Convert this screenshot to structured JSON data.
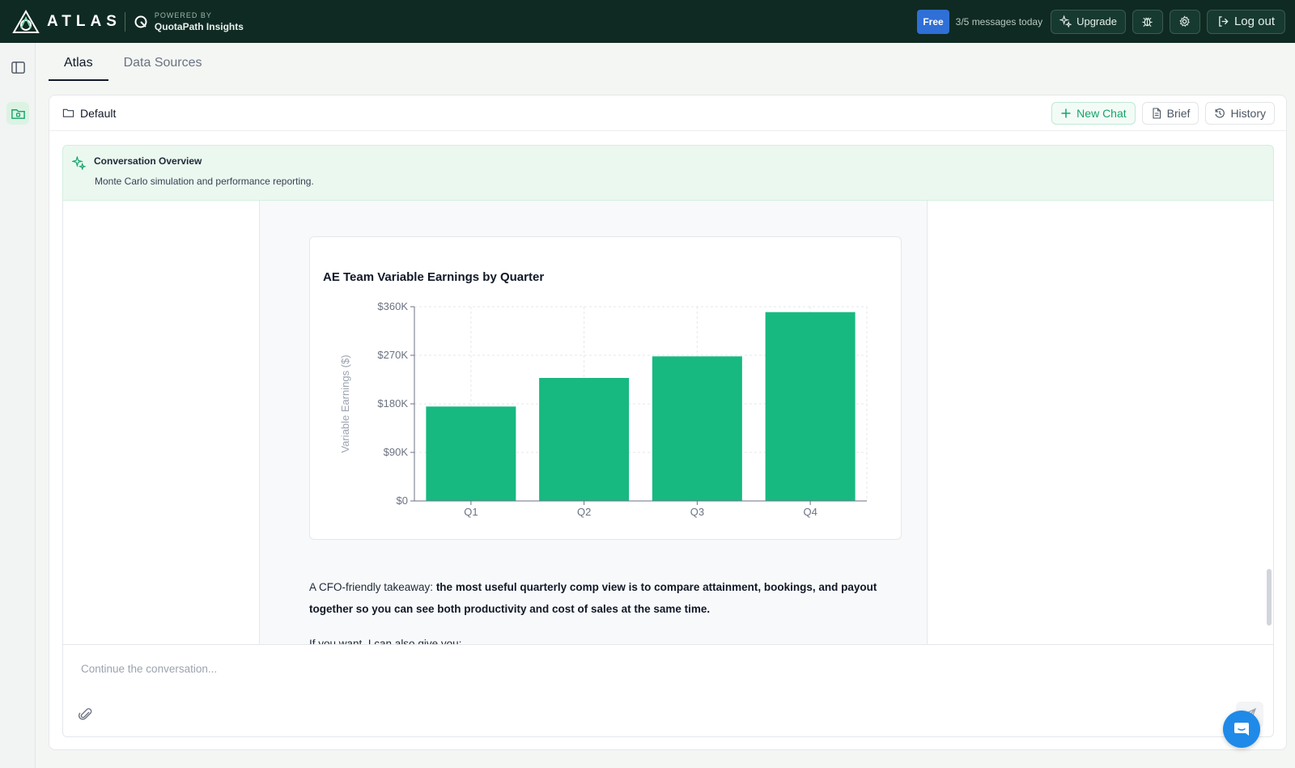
{
  "app": {
    "logo_text": "ATLAS",
    "powered_by": "POWERED BY",
    "powered_name": "QuotaPath Insights"
  },
  "topbar": {
    "plan_badge": "Free",
    "message_count": "3/5 messages today",
    "upgrade_label": "Upgrade",
    "logout_label": "Log out"
  },
  "tabs": [
    {
      "label": "Atlas"
    },
    {
      "label": "Data Sources"
    }
  ],
  "workspace": {
    "folder_name": "Default",
    "new_chat_label": "New Chat",
    "brief_label": "Brief",
    "history_label": "History"
  },
  "overview": {
    "title": "Conversation Overview",
    "summary": "Monte Carlo simulation and performance reporting."
  },
  "message": {
    "takeaway_intro": "A CFO-friendly takeaway: ",
    "takeaway_bold": "the most useful quarterly comp view is to compare attainment, bookings, and payout together so you can see both productivity and cost of sales at the same time.",
    "cutoff_line": "If you want, I can also give you:"
  },
  "composer": {
    "placeholder": "Continue the conversation..."
  },
  "colors": {
    "topbar_bg": "#0f2a22",
    "accent_green": "#17b981",
    "badge_blue": "#2f6fd6"
  },
  "chart_data": {
    "type": "bar",
    "title": "AE Team Variable Earnings by Quarter",
    "xlabel": "",
    "ylabel": "Variable Earnings ($)",
    "categories": [
      "Q1",
      "Q2",
      "Q3",
      "Q4"
    ],
    "values": [
      175000,
      228000,
      268000,
      350000
    ],
    "ylim": [
      0,
      360000
    ],
    "yticks": [
      0,
      90000,
      180000,
      270000,
      360000
    ],
    "ytick_labels": [
      "$0",
      "$90K",
      "$180K",
      "$270K",
      "$360K"
    ],
    "grid": true,
    "bar_color": "#17b981"
  }
}
